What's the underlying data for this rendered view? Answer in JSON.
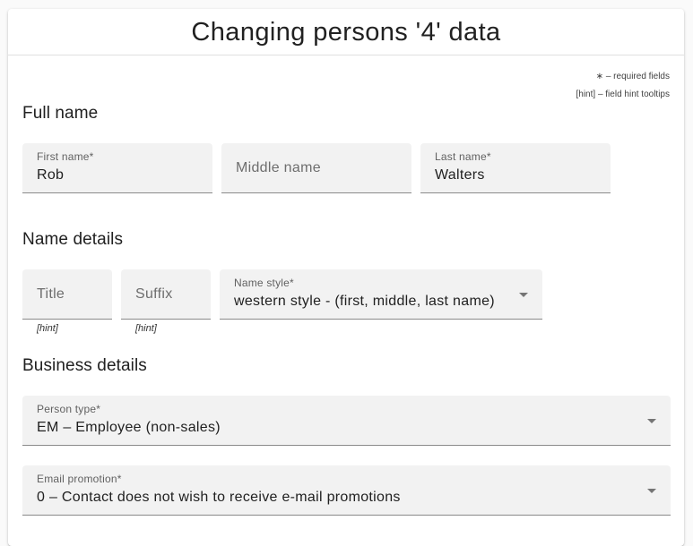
{
  "header": {
    "title": "Changing persons '4' data"
  },
  "legend": {
    "required": "∗ – required fields",
    "hint": "[hint] – field hint tooltips"
  },
  "sections": {
    "full_name": "Full name",
    "name_details": "Name details",
    "business_details": "Business details"
  },
  "fields": {
    "first_name": {
      "label": "First name*",
      "value": "Rob"
    },
    "middle_name": {
      "placeholder": "Middle name",
      "value": ""
    },
    "last_name": {
      "label": "Last name*",
      "value": "Walters"
    },
    "title": {
      "placeholder": "Title",
      "hint": "[hint]"
    },
    "suffix": {
      "placeholder": "Suffix",
      "hint": "[hint]"
    },
    "name_style": {
      "label": "Name style*",
      "value": "western style - (first, middle, last name)"
    },
    "person_type": {
      "label": "Person type*",
      "value": "EM – Employee (non-sales)"
    },
    "email_promotion": {
      "label": "Email promotion*",
      "value": "0 – Contact does not wish to receive e-mail promotions"
    }
  },
  "colors": {
    "field_bg": "#f2f2f2",
    "underline": "#8a8a8a",
    "card_bg": "#ffffff",
    "page_bg": "#fafafa"
  }
}
